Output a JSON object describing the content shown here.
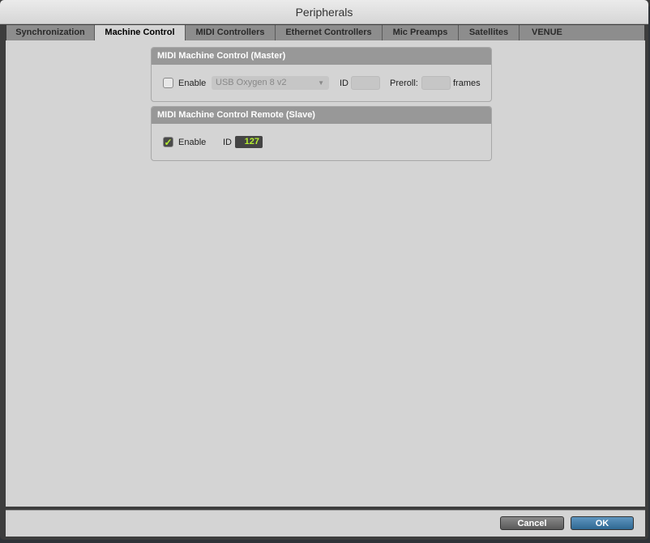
{
  "window": {
    "title": "Peripherals"
  },
  "tabs": [
    {
      "label": "Synchronization"
    },
    {
      "label": "Machine Control",
      "active": true
    },
    {
      "label": "MIDI Controllers"
    },
    {
      "label": "Ethernet Controllers"
    },
    {
      "label": "Mic Preamps"
    },
    {
      "label": "Satellites"
    },
    {
      "label": "VENUE"
    }
  ],
  "master": {
    "title": "MIDI Machine Control (Master)",
    "enable_label": "Enable",
    "enabled": false,
    "device": "USB Oxygen 8 v2",
    "id_label": "ID",
    "id_value": "",
    "preroll_label": "Preroll:",
    "preroll_value": "",
    "frames_label": "frames"
  },
  "slave": {
    "title": "MIDI Machine Control Remote (Slave)",
    "enable_label": "Enable",
    "enabled": true,
    "check_glyph": "✓",
    "id_label": "ID",
    "id_value": "127"
  },
  "buttons": {
    "cancel": "Cancel",
    "ok": "OK"
  },
  "colors": {
    "accent_ok": "#3a78a6",
    "id_text": "#b6f030"
  }
}
